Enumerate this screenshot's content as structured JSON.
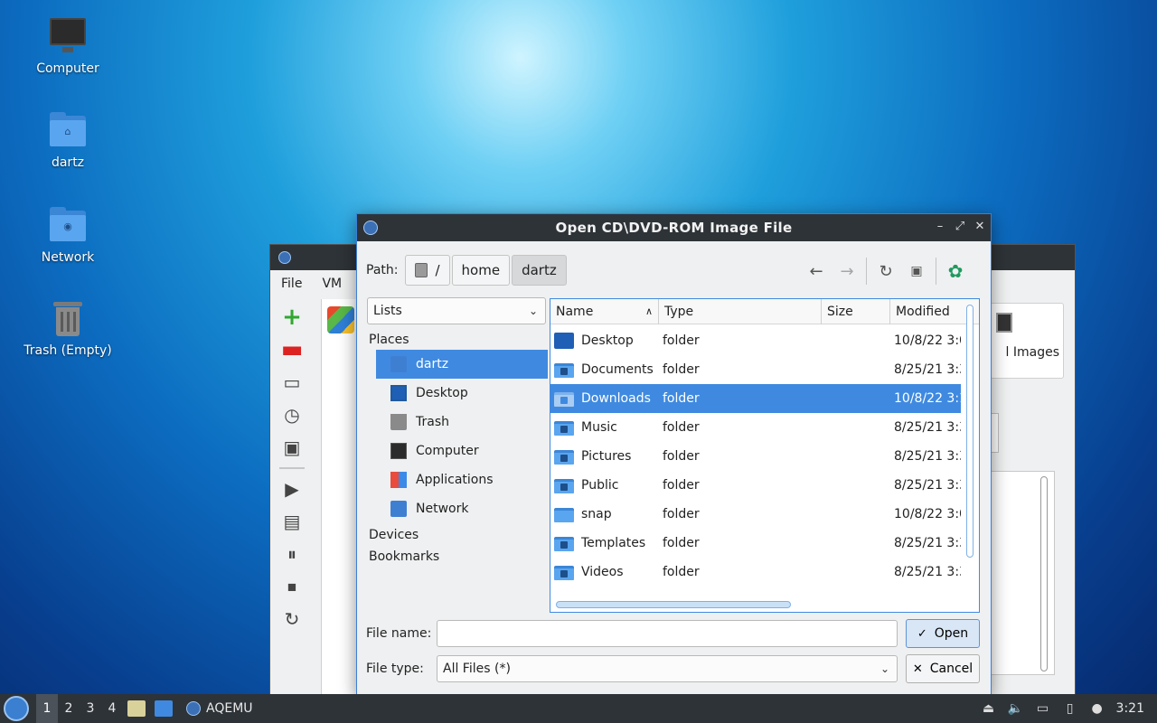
{
  "desktop": {
    "icons": [
      {
        "label": "Computer"
      },
      {
        "label": "dartz"
      },
      {
        "label": "Network"
      },
      {
        "label": "Trash (Empty)"
      }
    ]
  },
  "bg_window": {
    "menu": {
      "file": "File",
      "vm": "VM"
    },
    "right_card_label": "l Images"
  },
  "dialog": {
    "title": "Open CD\\DVD-ROM Image File",
    "path_label": "Path:",
    "breadcrumbs": [
      "/",
      "home",
      "dartz"
    ],
    "places_combo": "Lists",
    "sidebar": {
      "places_header": "Places",
      "items": [
        "dartz",
        "Desktop",
        "Trash",
        "Computer",
        "Applications",
        "Network"
      ],
      "devices_header": "Devices",
      "bookmarks_header": "Bookmarks"
    },
    "columns": [
      "Name",
      "Type",
      "Size",
      "Modified"
    ],
    "rows": [
      {
        "name": "Desktop",
        "type": "folder",
        "size": "",
        "modified": "10/8/22 3:0"
      },
      {
        "name": "Documents",
        "type": "folder",
        "size": "",
        "modified": "8/25/21 3:3"
      },
      {
        "name": "Downloads",
        "type": "folder",
        "size": "",
        "modified": "10/8/22 3:1"
      },
      {
        "name": "Music",
        "type": "folder",
        "size": "",
        "modified": "8/25/21 3:3"
      },
      {
        "name": "Pictures",
        "type": "folder",
        "size": "",
        "modified": "8/25/21 3:3"
      },
      {
        "name": "Public",
        "type": "folder",
        "size": "",
        "modified": "8/25/21 3:3"
      },
      {
        "name": "snap",
        "type": "folder",
        "size": "",
        "modified": "10/8/22 3:0"
      },
      {
        "name": "Templates",
        "type": "folder",
        "size": "",
        "modified": "8/25/21 3:3"
      },
      {
        "name": "Videos",
        "type": "folder",
        "size": "",
        "modified": "8/25/21 3:3"
      }
    ],
    "selected_row": "Downloads",
    "file_name_label": "File name:",
    "file_name_value": "",
    "file_type_label": "File type:",
    "file_type_value": "All Files (*)",
    "open_label": "Open",
    "cancel_label": "Cancel"
  },
  "taskbar": {
    "workspaces": [
      "1",
      "2",
      "3",
      "4"
    ],
    "task_label": "AQEMU",
    "clock": "3:21"
  },
  "colors": {
    "selection": "#3f8ae0",
    "titlebar": "#2e3338",
    "window_bg": "#eff0f1"
  }
}
